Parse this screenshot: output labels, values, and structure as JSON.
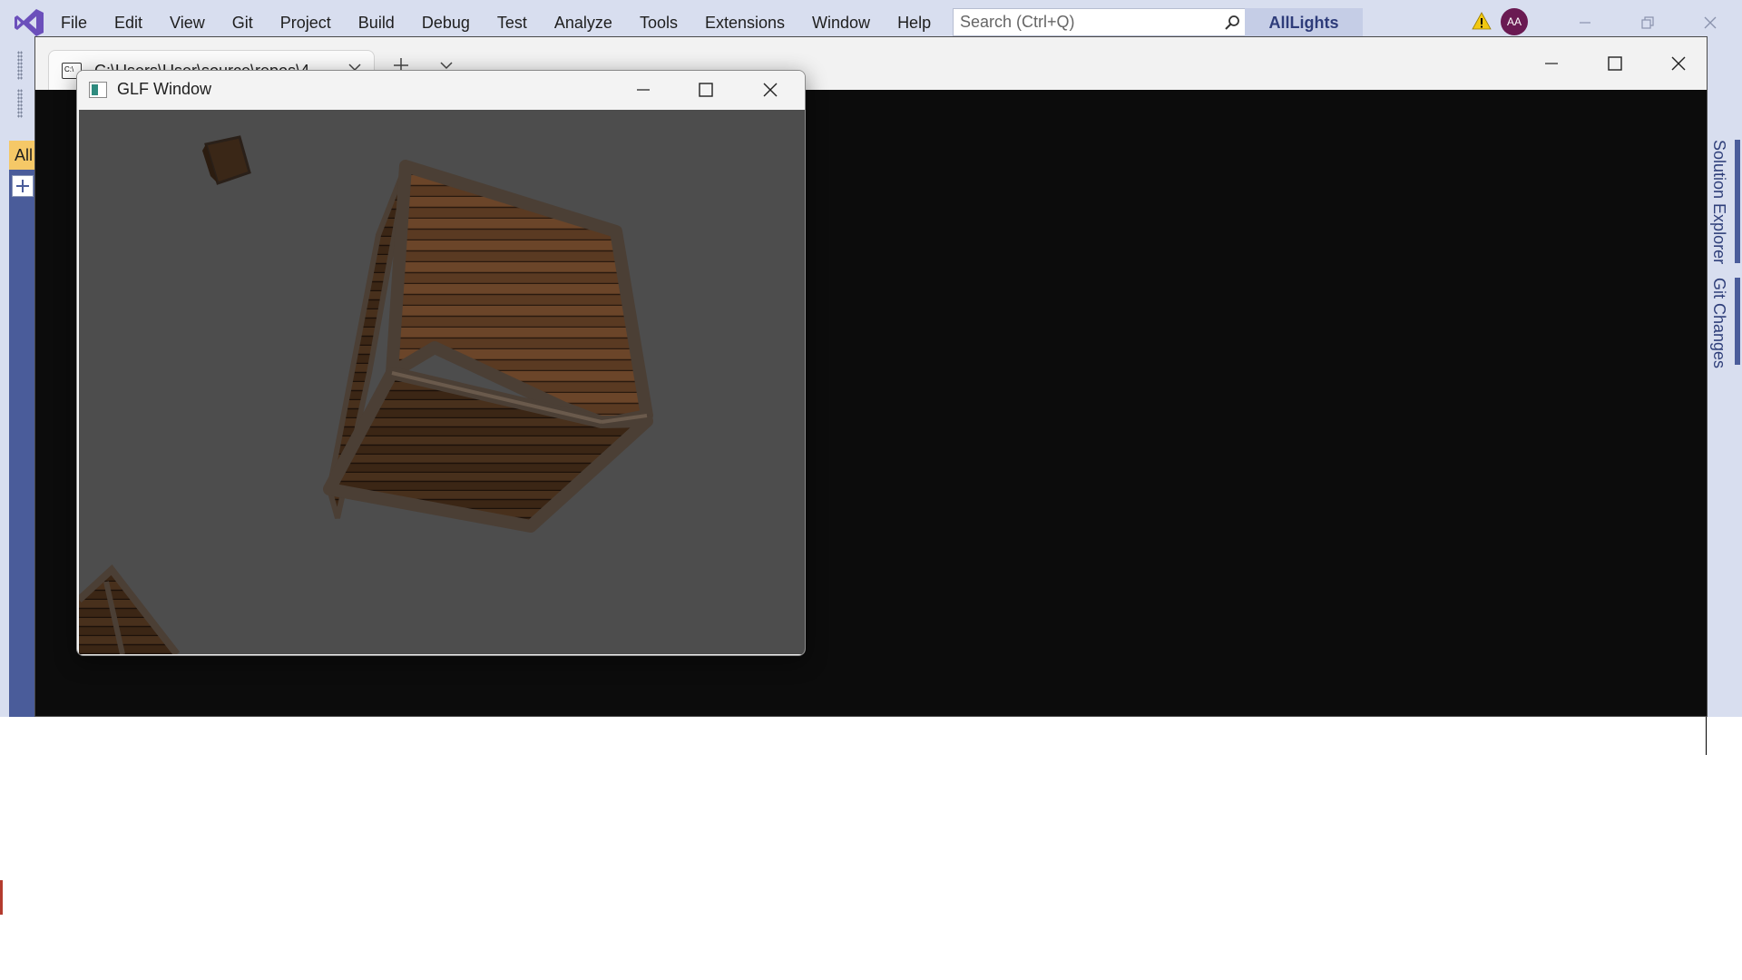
{
  "vs": {
    "menu": [
      "File",
      "Edit",
      "View",
      "Git",
      "Project",
      "Build",
      "Debug",
      "Test",
      "Analyze",
      "Tools",
      "Extensions",
      "Window",
      "Help"
    ],
    "search_placeholder": "Search (Ctrl+Q)",
    "solution_name": "AllLights",
    "avatar_initials": "AA",
    "toolbox_tab_label": "All",
    "side_tabs": [
      "Solution Explorer",
      "Git Changes"
    ]
  },
  "console": {
    "tab_title": "C:\\Users\\User\\source\\repos\\4",
    "tab_icon_text": "C:\\"
  },
  "glf_window": {
    "title": "GLF Window"
  },
  "colors": {
    "vs_chrome": "#d8deef",
    "vs_accent": "#4a5c9a",
    "console_bg": "#0c0c0c",
    "glf_clear": "#4d4d4d",
    "crate_wood": "#5a3a22",
    "crate_frame": "#4b3f35"
  }
}
